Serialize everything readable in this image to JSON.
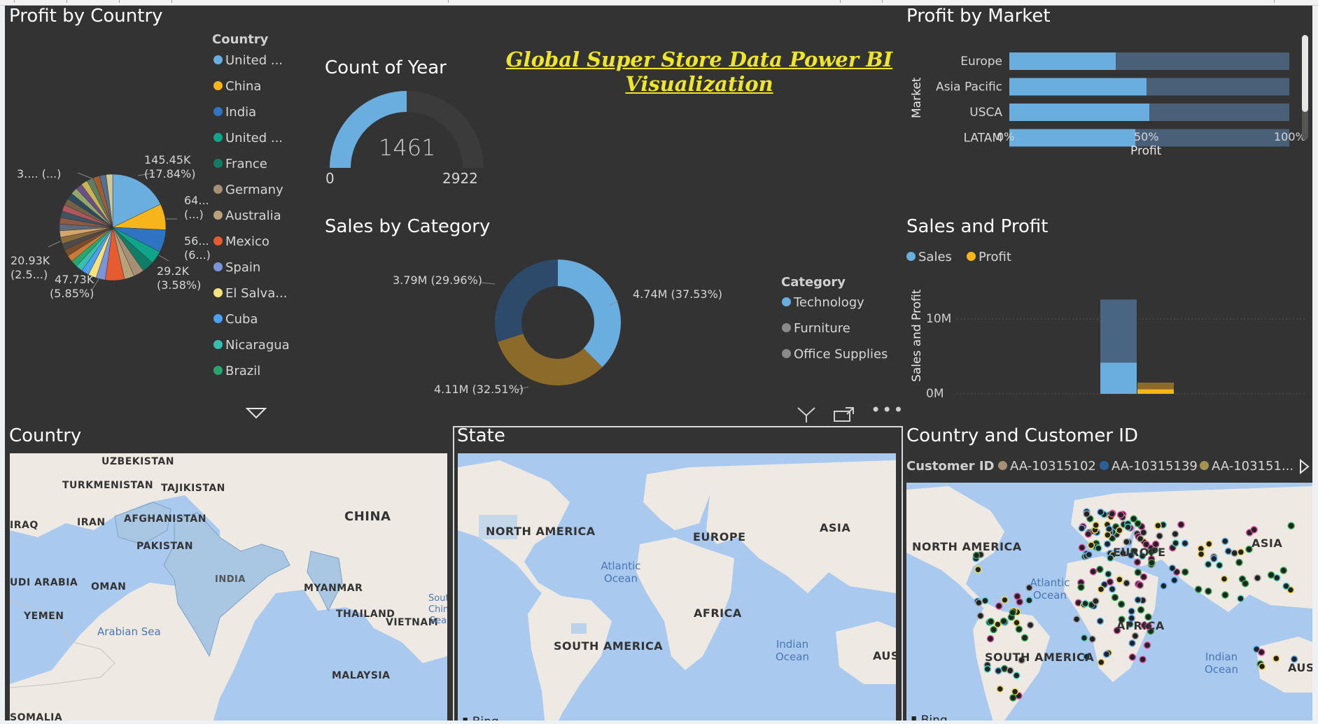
{
  "dashboard": {
    "title": "Global Super Store Data  Power BI Visualization"
  },
  "profit_by_country": {
    "title": "Profit by Country",
    "legend_title": "Country",
    "legend_items": [
      {
        "label": "United ...",
        "color": "#6aaee0"
      },
      {
        "label": "China",
        "color": "#f7b41b"
      },
      {
        "label": "India",
        "color": "#2f73c3"
      },
      {
        "label": "United ...",
        "color": "#10a58a"
      },
      {
        "label": "France",
        "color": "#127d67"
      },
      {
        "label": "Germany",
        "color": "#a78e77"
      },
      {
        "label": "Australia",
        "color": "#b8a27a"
      },
      {
        "label": "Mexico",
        "color": "#e65b2f"
      },
      {
        "label": "Spain",
        "color": "#7a93d9"
      },
      {
        "label": "El Salva...",
        "color": "#f6e27a"
      },
      {
        "label": "Cuba",
        "color": "#4d9ff0"
      },
      {
        "label": "Nicaragua",
        "color": "#36bfae"
      },
      {
        "label": "Brazil",
        "color": "#2aa56e"
      }
    ],
    "labels": {
      "top": "145.45K",
      "top_pct": "(17.84%)",
      "right1": "64...",
      "right1b": "(...)",
      "right2": "56...",
      "right2b": "(6...)",
      "bottom_right": "29.2K",
      "bottom_right_pct": "(3.58%)",
      "bottom": "47.73K",
      "bottom_pct": "(5.85%)",
      "left": "20.93K",
      "left_pct": "(2.5...)",
      "top_left": "3.... (...)"
    },
    "expand_icon": "triangle-down-icon"
  },
  "count_of_year": {
    "title": "Count of Year",
    "value_label": "1461",
    "value": 1461,
    "min_label": "0",
    "max_label": "2922",
    "max": 2922,
    "color": "#6aaee0"
  },
  "sales_by_category": {
    "title": "Sales by Category",
    "legend_title": "Category",
    "legend_items": [
      {
        "label": "Technology",
        "color": "#6aaee0"
      },
      {
        "label": "Furniture",
        "color": "#8a8a8a"
      },
      {
        "label": "Office Supplies",
        "color": "#8a8a8a"
      }
    ],
    "label_technology": "4.74M (37.53%)",
    "label_furniture": "3.79M (29.96%)",
    "label_office": "4.11M (32.51%)",
    "toolbar": {
      "filter_icon": "filter-icon",
      "focus_icon": "focus-mode-icon",
      "more_icon": "more-options-icon"
    }
  },
  "profit_by_market": {
    "title": "Profit by Market",
    "y_axis_title": "Market",
    "x_axis_title": "Profit",
    "ticks": [
      "0%",
      "50%",
      "100%"
    ]
  },
  "sales_and_profit": {
    "title": "Sales and Profit",
    "legend": [
      {
        "label": "Sales",
        "color": "#6aaee0"
      },
      {
        "label": "Profit",
        "color": "#f7b41b"
      }
    ],
    "y_axis_title": "Sales and Profit",
    "ticks": [
      "10M",
      "0M"
    ]
  },
  "country_map": {
    "title": "Country",
    "labels": {
      "uzbekistan": "UZBEKISTAN",
      "turkmenistan": "TURKMENISTAN",
      "tajikistan": "TAJIKISTAN",
      "china": "CHINA",
      "iraq": "IRAQ",
      "iran": "IRAN",
      "afghanistan": "AFGHANISTAN",
      "pakistan": "PAKISTAN",
      "india": "INDIA",
      "saudi": "UDI ARABIA",
      "oman": "OMAN",
      "myanmar": "MYANMAR",
      "yemen": "YEMEN",
      "arabian_sea": "Arabian Sea",
      "thailand": "THAILAND",
      "vietnam": "VIETNAM",
      "south_china_sea": "Sout Chin Sea",
      "malaysia": "MALAYSIA",
      "somalia": "SOMALIA"
    },
    "bing": "Bing"
  },
  "state_map": {
    "title": "State",
    "labels": {
      "north_america": "NORTH AMERICA",
      "europe": "EUROPE",
      "asia": "ASIA",
      "atlantic": "Atlantic Ocean",
      "africa": "AFRICA",
      "south_america": "SOUTH AMERICA",
      "indian": "Indian Ocean",
      "austra": "AUSTRA"
    },
    "bing": "Bing"
  },
  "customer_map": {
    "title": "Country and Customer ID",
    "legend_title": "Customer ID",
    "legend_items": [
      {
        "label": "AA-10315102",
        "color": "#a68f72"
      },
      {
        "label": "AA-10315139",
        "color": "#2b5f99"
      },
      {
        "label": "AA-103151...",
        "color": "#a6924f"
      }
    ],
    "labels": {
      "north_america": "NORTH AMERICA",
      "europe": "EUROPE",
      "asia": "ASIA",
      "atlantic": "Atlantic Ocean",
      "africa": "AFRICA",
      "south_america": "SOUTH AMERICA",
      "indian": "Indian Ocean",
      "aust": "AUST"
    },
    "bing": "Bing"
  },
  "chart_data": [
    {
      "type": "pie",
      "title": "Profit by Country",
      "categories": [
        "United ...",
        "China",
        "India",
        "United ...",
        "France",
        "Germany",
        "Australia",
        "Mexico",
        "Spain",
        "El Salva...",
        "Cuba",
        "Nicaragua",
        "Brazil"
      ],
      "labeled_values": [
        {
          "value": "145.45K",
          "percent": 17.84
        },
        {
          "value": "64...",
          "percent": null
        },
        {
          "value": "56...",
          "percent": null
        },
        {
          "value": "29.2K",
          "percent": 3.58
        },
        {
          "value": "47.73K",
          "percent": 5.85
        },
        {
          "value": "20.93K",
          "percent": 2.5
        }
      ]
    },
    {
      "type": "pie",
      "title": "Sales by Category",
      "categories": [
        "Technology",
        "Office Supplies",
        "Furniture"
      ],
      "values": [
        4.74,
        4.11,
        3.79
      ],
      "percent": [
        37.53,
        32.51,
        29.96
      ],
      "unit": "M"
    },
    {
      "type": "bar",
      "title": "Profit by Market",
      "orientation": "horizontal",
      "stacked_percent": true,
      "categories": [
        "Europe",
        "Asia Pacific",
        "USCA",
        "LATAM"
      ],
      "values_percent": [
        38,
        49,
        50,
        45
      ],
      "xlabel": "Profit",
      "ylabel": "Market",
      "xlim": [
        0,
        100
      ]
    },
    {
      "type": "bar",
      "title": "Sales and Profit",
      "series": [
        {
          "name": "Sales",
          "values": [
            12.6
          ]
        },
        {
          "name": "Profit",
          "values": [
            1.5
          ]
        }
      ],
      "ylabel": "Sales and Profit",
      "ylim": [
        0,
        12.6
      ],
      "unit": "M"
    }
  ]
}
